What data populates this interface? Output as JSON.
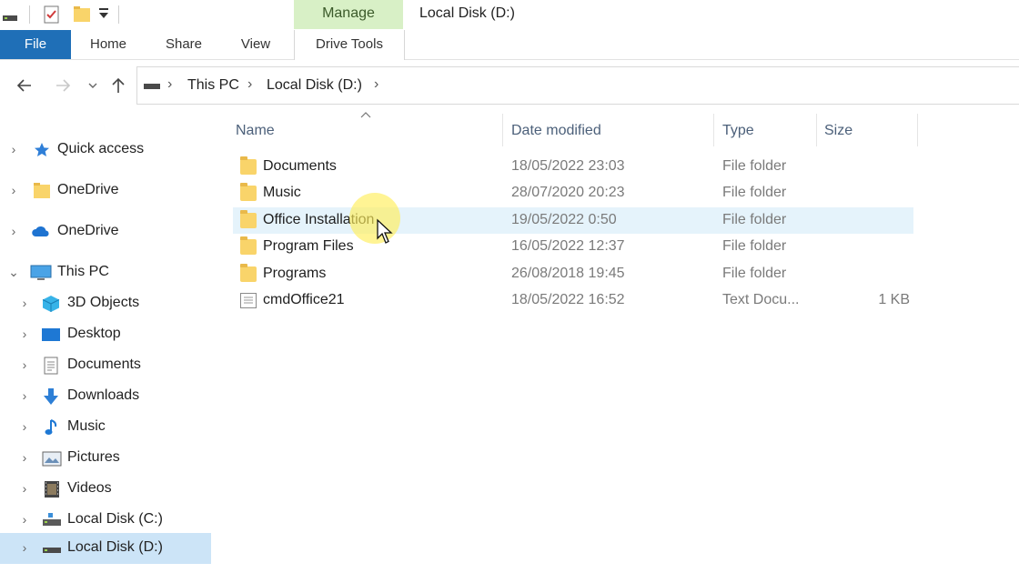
{
  "ribbon": {
    "manage_label": "Manage",
    "window_title": "Local Disk (D:)",
    "tabs": {
      "file": "File",
      "home": "Home",
      "share": "Share",
      "view": "View",
      "drive_tools": "Drive Tools"
    }
  },
  "address_bar": {
    "crumbs": [
      "This PC",
      "Local Disk (D:)"
    ]
  },
  "navigation": {
    "items": [
      {
        "label": "Quick access",
        "icon": "star-icon"
      },
      {
        "label": "OneDrive",
        "icon": "folder-icon"
      },
      {
        "label": "OneDrive",
        "icon": "cloud-icon"
      },
      {
        "label": "This PC",
        "icon": "computer-icon"
      },
      {
        "label": "3D Objects",
        "icon": "cube-icon"
      },
      {
        "label": "Desktop",
        "icon": "desktop-icon"
      },
      {
        "label": "Documents",
        "icon": "document-icon"
      },
      {
        "label": "Downloads",
        "icon": "download-icon"
      },
      {
        "label": "Music",
        "icon": "music-icon"
      },
      {
        "label": "Pictures",
        "icon": "pictures-icon"
      },
      {
        "label": "Videos",
        "icon": "video-icon"
      },
      {
        "label": "Local Disk (C:)",
        "icon": "drive-icon"
      },
      {
        "label": "Local Disk (D:)",
        "icon": "drive-icon"
      }
    ],
    "selected": "Local Disk (D:)"
  },
  "file_list": {
    "columns": {
      "name": "Name",
      "date": "Date modified",
      "type": "Type",
      "size": "Size"
    },
    "rows": [
      {
        "name": "Documents",
        "date": "18/05/2022 23:03",
        "type": "File folder",
        "size": ""
      },
      {
        "name": "Music",
        "date": "28/07/2020 20:23",
        "type": "File folder",
        "size": ""
      },
      {
        "name": "Office Installation",
        "date": "19/05/2022 0:50",
        "type": "File folder",
        "size": ""
      },
      {
        "name": "Program Files",
        "date": "16/05/2022 12:37",
        "type": "File folder",
        "size": ""
      },
      {
        "name": "Programs",
        "date": "26/08/2018 19:45",
        "type": "File folder",
        "size": ""
      },
      {
        "name": "cmdOffice21",
        "date": "18/05/2022 16:52",
        "type": "Text Docu...",
        "size": "1 KB"
      }
    ],
    "hovered_row": "Office Installation"
  },
  "colors": {
    "file_tab": "#1f6fb7",
    "manage_tab": "#d8f0c6",
    "selected_nav": "#cce4f7",
    "hover_row": "#e5f3fb",
    "folder": "#f9d46a"
  }
}
